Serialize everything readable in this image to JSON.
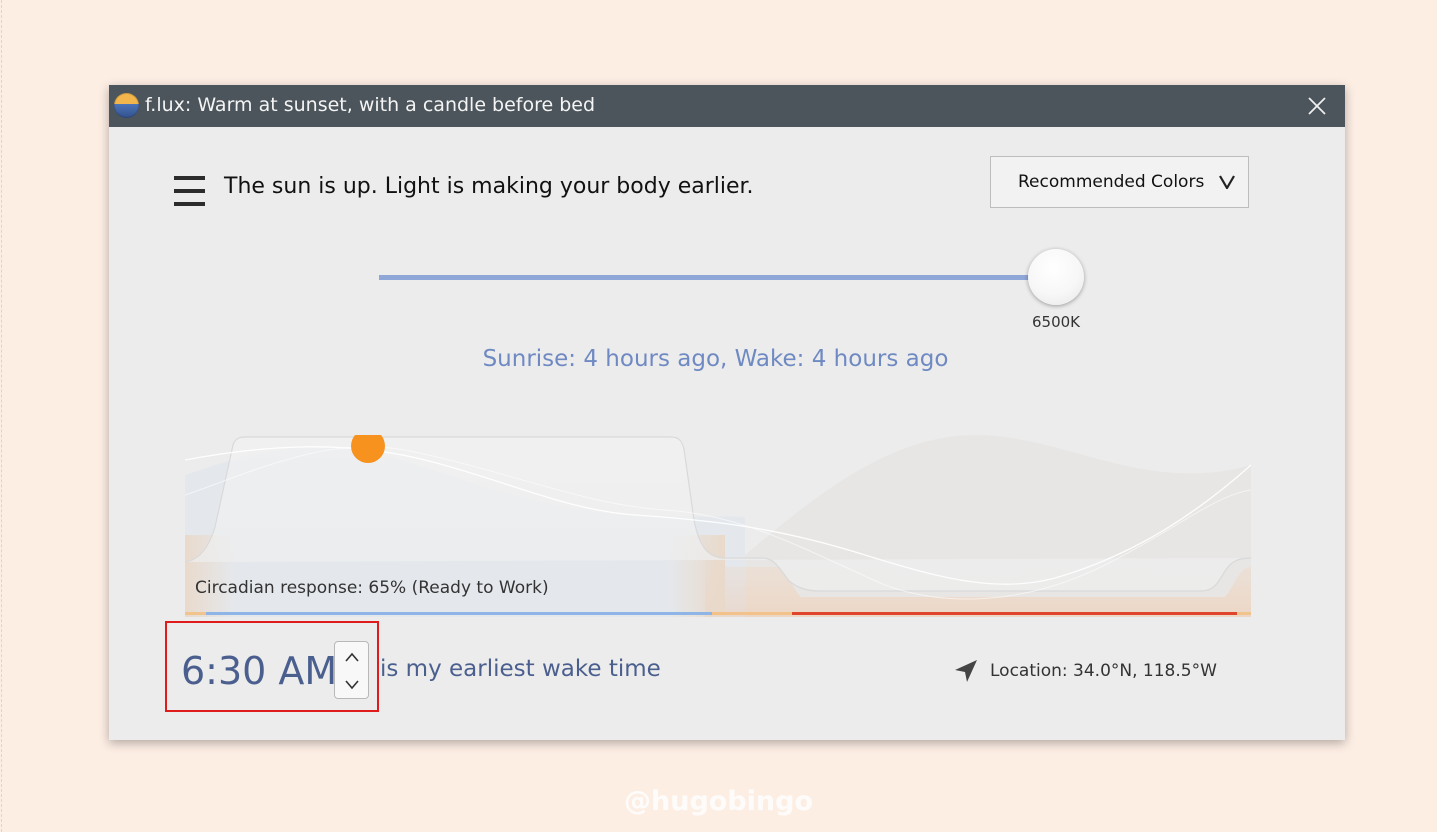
{
  "window": {
    "title": "f.lux: Warm at sunset, with a candle before bed",
    "icons": {
      "app": "flux-sun-icon",
      "close": "close-icon"
    }
  },
  "header": {
    "status": "The sun is up. Light is making your body earlier.",
    "menu_icon": "hamburger-menu-icon",
    "preset": {
      "selected": "Recommended Colors",
      "chevron": "chevron-down-icon"
    }
  },
  "color_temperature": {
    "value_label": "6500K",
    "level_fraction": 1.0
  },
  "info": {
    "sunrise_wake": "Sunrise: 4 hours ago, Wake: 4 hours ago"
  },
  "circadian": {
    "response": "Circadian response: 65% (Ready to Work)"
  },
  "wake": {
    "time": "6:30 AM",
    "label": "is my earliest wake time",
    "up_icon": "chevron-up-icon",
    "down_icon": "chevron-down-icon"
  },
  "location": {
    "text": "Location: 34.0°N, 118.5°W",
    "icon": "location-arrow-icon"
  },
  "watermark": "@hugobingo",
  "colors": {
    "titlebar": "#4b555b",
    "accent_blue": "#8fa7d8",
    "sun": "#f7921e",
    "highlight_box": "#e01b1b",
    "night_red": "#e0452c",
    "evening_orange": "#f5c79a"
  }
}
